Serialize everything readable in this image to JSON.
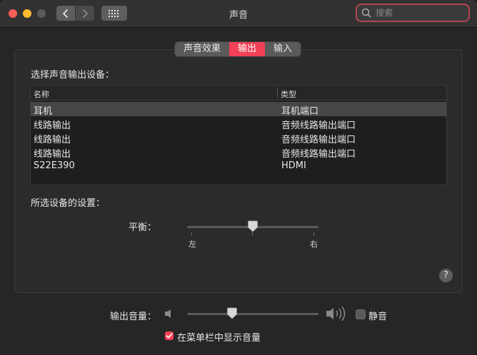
{
  "window": {
    "title": "声音"
  },
  "search": {
    "placeholder": "搜索"
  },
  "tabs": [
    {
      "label": "声音效果",
      "active": false
    },
    {
      "label": "输出",
      "active": true
    },
    {
      "label": "输入",
      "active": false
    }
  ],
  "output": {
    "device_section_label": "选择声音输出设备：",
    "table": {
      "headers": {
        "name": "名称",
        "type": "类型"
      },
      "rows": [
        {
          "name": "耳机",
          "type": "耳机端口",
          "selected": true
        },
        {
          "name": "线路输出",
          "type": "音频线路输出端口",
          "selected": false
        },
        {
          "name": "线路输出",
          "type": "音频线路输出端口",
          "selected": false
        },
        {
          "name": "线路输出",
          "type": "音频线路输出端口",
          "selected": false
        },
        {
          "name": "S22E390",
          "type": "HDMI",
          "selected": false
        }
      ]
    },
    "settings_label": "所选设备的设置：",
    "balance": {
      "label": "平衡：",
      "left_label": "左",
      "right_label": "右",
      "value": 0.5
    }
  },
  "footer": {
    "volume_label": "输出音量：",
    "volume_value": 0.34,
    "mute_label": "静音",
    "mute_checked": false,
    "show_in_menubar_label": "在菜单栏中显示音量",
    "show_in_menubar_checked": true
  },
  "colors": {
    "accent": "#f24156",
    "search_focus": "#b4454f"
  },
  "icons": {
    "back": "chevron-left-icon",
    "forward": "chevron-right-icon",
    "grid": "grid-icon",
    "search": "search-icon",
    "speaker_low": "speaker-low-icon",
    "speaker_high": "speaker-high-icon",
    "help": "help-icon"
  }
}
